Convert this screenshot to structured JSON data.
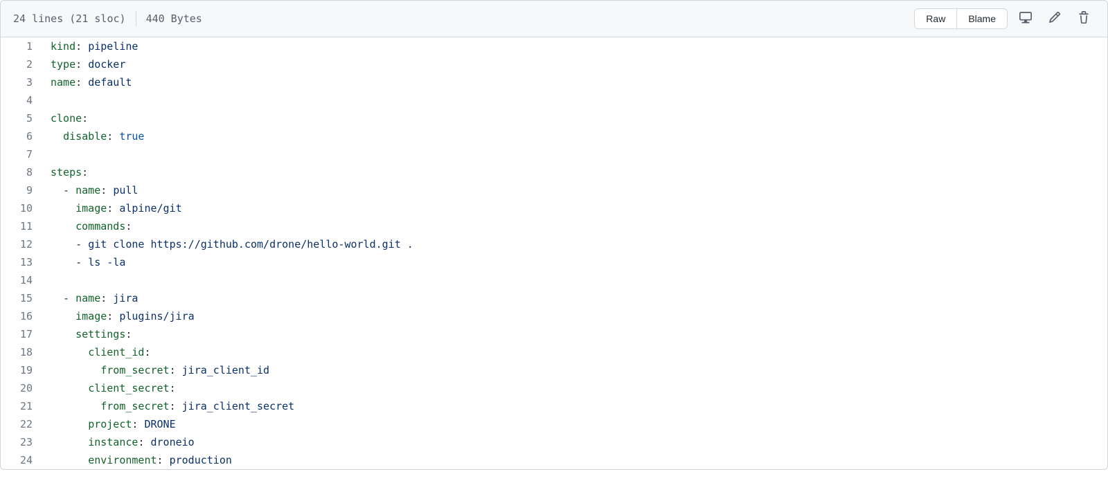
{
  "header": {
    "lines_info": "24 lines (21 sloc)",
    "size_info": "440 Bytes",
    "raw_label": "Raw",
    "blame_label": "Blame"
  },
  "code": {
    "lines": [
      {
        "n": 1,
        "tokens": [
          {
            "t": "kind",
            "c": "pl-ent"
          },
          {
            "t": ": "
          },
          {
            "t": "pipeline",
            "c": "pl-s"
          }
        ]
      },
      {
        "n": 2,
        "tokens": [
          {
            "t": "type",
            "c": "pl-ent"
          },
          {
            "t": ": "
          },
          {
            "t": "docker",
            "c": "pl-s"
          }
        ]
      },
      {
        "n": 3,
        "tokens": [
          {
            "t": "name",
            "c": "pl-ent"
          },
          {
            "t": ": "
          },
          {
            "t": "default",
            "c": "pl-s"
          }
        ]
      },
      {
        "n": 4,
        "tokens": []
      },
      {
        "n": 5,
        "tokens": [
          {
            "t": "clone",
            "c": "pl-ent"
          },
          {
            "t": ":"
          }
        ]
      },
      {
        "n": 6,
        "tokens": [
          {
            "t": "  "
          },
          {
            "t": "disable",
            "c": "pl-ent"
          },
          {
            "t": ": "
          },
          {
            "t": "true",
            "c": "pl-c1"
          }
        ]
      },
      {
        "n": 7,
        "tokens": []
      },
      {
        "n": 8,
        "tokens": [
          {
            "t": "steps",
            "c": "pl-ent"
          },
          {
            "t": ":"
          }
        ]
      },
      {
        "n": 9,
        "tokens": [
          {
            "t": "  - "
          },
          {
            "t": "name",
            "c": "pl-ent"
          },
          {
            "t": ": "
          },
          {
            "t": "pull",
            "c": "pl-s"
          }
        ]
      },
      {
        "n": 10,
        "tokens": [
          {
            "t": "    "
          },
          {
            "t": "image",
            "c": "pl-ent"
          },
          {
            "t": ": "
          },
          {
            "t": "alpine/git",
            "c": "pl-s"
          }
        ]
      },
      {
        "n": 11,
        "tokens": [
          {
            "t": "    "
          },
          {
            "t": "commands",
            "c": "pl-ent"
          },
          {
            "t": ":"
          }
        ]
      },
      {
        "n": 12,
        "tokens": [
          {
            "t": "    - "
          },
          {
            "t": "git clone https://github.com/drone/hello-world.git .",
            "c": "pl-s"
          }
        ]
      },
      {
        "n": 13,
        "tokens": [
          {
            "t": "    - "
          },
          {
            "t": "ls -la",
            "c": "pl-s"
          }
        ]
      },
      {
        "n": 14,
        "tokens": []
      },
      {
        "n": 15,
        "tokens": [
          {
            "t": "  - "
          },
          {
            "t": "name",
            "c": "pl-ent"
          },
          {
            "t": ": "
          },
          {
            "t": "jira",
            "c": "pl-s"
          }
        ]
      },
      {
        "n": 16,
        "tokens": [
          {
            "t": "    "
          },
          {
            "t": "image",
            "c": "pl-ent"
          },
          {
            "t": ": "
          },
          {
            "t": "plugins/jira",
            "c": "pl-s"
          }
        ]
      },
      {
        "n": 17,
        "tokens": [
          {
            "t": "    "
          },
          {
            "t": "settings",
            "c": "pl-ent"
          },
          {
            "t": ":"
          }
        ]
      },
      {
        "n": 18,
        "tokens": [
          {
            "t": "      "
          },
          {
            "t": "client_id",
            "c": "pl-ent"
          },
          {
            "t": ":"
          }
        ]
      },
      {
        "n": 19,
        "tokens": [
          {
            "t": "        "
          },
          {
            "t": "from_secret",
            "c": "pl-ent"
          },
          {
            "t": ": "
          },
          {
            "t": "jira_client_id",
            "c": "pl-s"
          }
        ]
      },
      {
        "n": 20,
        "tokens": [
          {
            "t": "      "
          },
          {
            "t": "client_secret",
            "c": "pl-ent"
          },
          {
            "t": ":"
          }
        ]
      },
      {
        "n": 21,
        "tokens": [
          {
            "t": "        "
          },
          {
            "t": "from_secret",
            "c": "pl-ent"
          },
          {
            "t": ": "
          },
          {
            "t": "jira_client_secret",
            "c": "pl-s"
          }
        ]
      },
      {
        "n": 22,
        "tokens": [
          {
            "t": "      "
          },
          {
            "t": "project",
            "c": "pl-ent"
          },
          {
            "t": ": "
          },
          {
            "t": "DRONE",
            "c": "pl-s"
          }
        ]
      },
      {
        "n": 23,
        "tokens": [
          {
            "t": "      "
          },
          {
            "t": "instance",
            "c": "pl-ent"
          },
          {
            "t": ": "
          },
          {
            "t": "droneio",
            "c": "pl-s"
          }
        ]
      },
      {
        "n": 24,
        "tokens": [
          {
            "t": "      "
          },
          {
            "t": "environment",
            "c": "pl-ent"
          },
          {
            "t": ": "
          },
          {
            "t": "production",
            "c": "pl-s"
          }
        ]
      }
    ]
  }
}
